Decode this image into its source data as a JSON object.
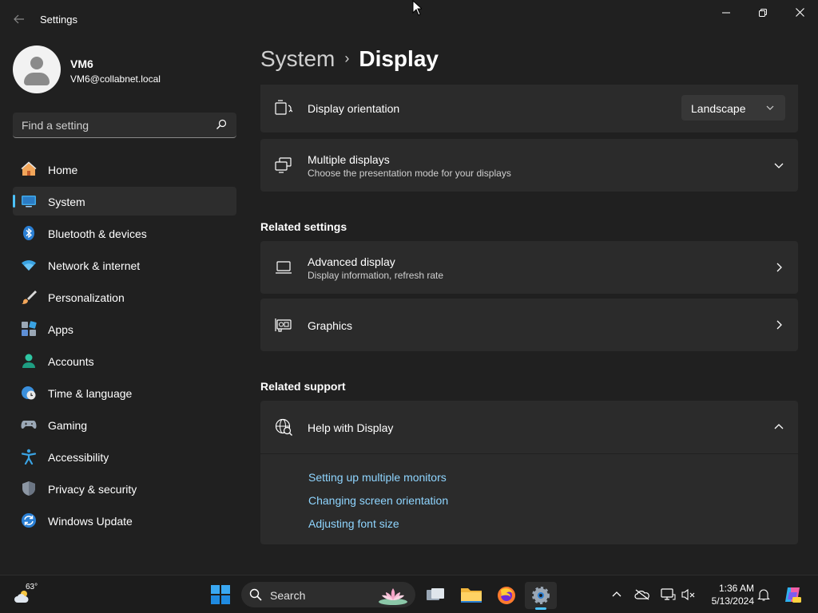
{
  "window": {
    "app_title": "Settings",
    "back_icon": "back-arrow-icon",
    "minimize_icon": "minimize-icon",
    "restore_icon": "restore-icon",
    "close_icon": "close-icon"
  },
  "profile": {
    "name": "VM6",
    "email": "VM6@collabnet.local"
  },
  "search": {
    "placeholder": "Find a setting"
  },
  "sidebar": {
    "items": [
      {
        "label": "Home",
        "icon": "home-icon",
        "active": false
      },
      {
        "label": "System",
        "icon": "system-icon",
        "active": true
      },
      {
        "label": "Bluetooth & devices",
        "icon": "bluetooth-icon",
        "active": false
      },
      {
        "label": "Network & internet",
        "icon": "wifi-icon",
        "active": false
      },
      {
        "label": "Personalization",
        "icon": "brush-icon",
        "active": false
      },
      {
        "label": "Apps",
        "icon": "apps-icon",
        "active": false
      },
      {
        "label": "Accounts",
        "icon": "accounts-icon",
        "active": false
      },
      {
        "label": "Time & language",
        "icon": "globe-clock-icon",
        "active": false
      },
      {
        "label": "Gaming",
        "icon": "gamepad-icon",
        "active": false
      },
      {
        "label": "Accessibility",
        "icon": "accessibility-icon",
        "active": false
      },
      {
        "label": "Privacy & security",
        "icon": "shield-icon",
        "active": false
      },
      {
        "label": "Windows Update",
        "icon": "update-icon",
        "active": false
      }
    ]
  },
  "breadcrumb": {
    "parent": "System",
    "separator": "›",
    "current": "Display"
  },
  "cards": {
    "orientation": {
      "title": "Display orientation",
      "value": "Landscape"
    },
    "multiple": {
      "title": "Multiple displays",
      "subtitle": "Choose the presentation mode for your displays"
    },
    "advanced": {
      "title": "Advanced display",
      "subtitle": "Display information, refresh rate"
    },
    "graphics": {
      "title": "Graphics"
    },
    "help": {
      "title": "Help with Display"
    }
  },
  "sections": {
    "related_settings": "Related settings",
    "related_support": "Related support"
  },
  "help_links": [
    "Setting up multiple monitors",
    "Changing screen orientation",
    "Adjusting font size"
  ],
  "taskbar": {
    "weather_temp": "63°",
    "search_label": "Search",
    "time": "1:36 AM",
    "date": "5/13/2024"
  },
  "colors": {
    "accent": "#4cc2ff",
    "link": "#8fd5ff",
    "background": "#202020",
    "card": "#2b2b2b"
  }
}
